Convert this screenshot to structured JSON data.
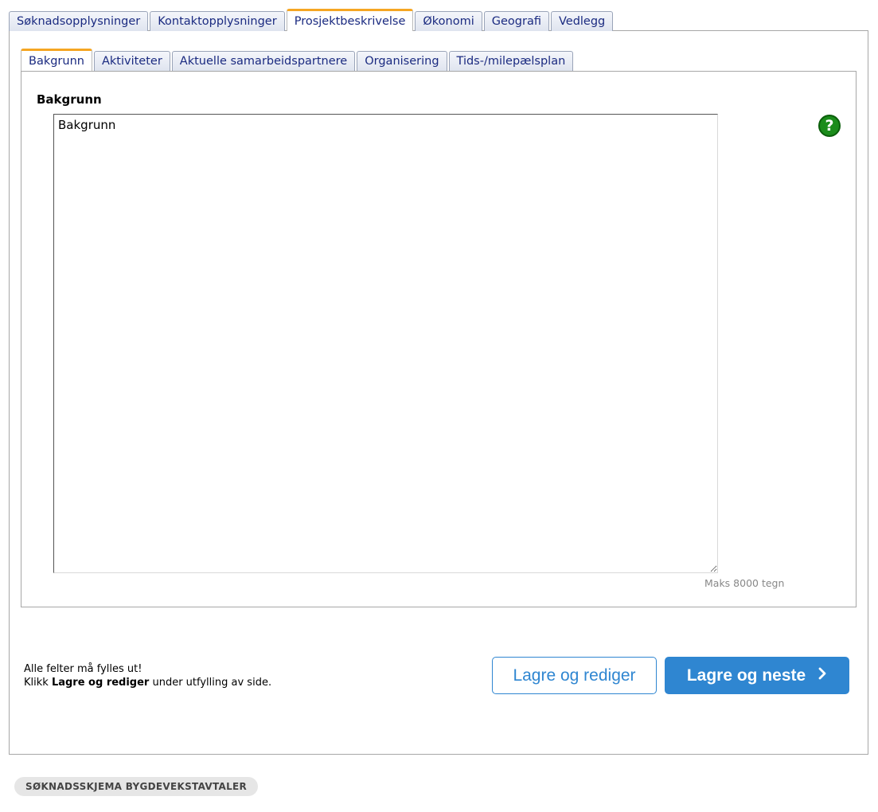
{
  "outer_tabs": [
    {
      "label": "Søknadsopplysninger",
      "active": false
    },
    {
      "label": "Kontaktopplysninger",
      "active": false
    },
    {
      "label": "Prosjektbeskrivelse",
      "active": true
    },
    {
      "label": "Økonomi",
      "active": false
    },
    {
      "label": "Geografi",
      "active": false
    },
    {
      "label": "Vedlegg",
      "active": false
    }
  ],
  "inner_tabs": [
    {
      "label": "Bakgrunn",
      "active": true
    },
    {
      "label": "Aktiviteter",
      "active": false
    },
    {
      "label": "Aktuelle samarbeidspartnere",
      "active": false
    },
    {
      "label": "Organisering",
      "active": false
    },
    {
      "label": "Tids-/milepælsplan",
      "active": false
    }
  ],
  "section": {
    "title": "Bakgrunn",
    "textarea_value": "Bakgrunn",
    "help_icon": "question-icon",
    "char_limit": "Maks 8000 tegn"
  },
  "notes": {
    "line1": "Alle felter må fylles ut!",
    "line2_prefix": "Klikk ",
    "line2_bold": "Lagre og rediger",
    "line2_suffix": " under utfylling av side."
  },
  "buttons": {
    "save_edit": "Lagre og rediger",
    "save_next": "Lagre og neste",
    "save_next_icon": "chevron-right-icon"
  },
  "footer": {
    "badge": "SØKNADSSKJEMA BYGDEVEKSTAVTALER"
  },
  "colors": {
    "accent": "#2f86d1",
    "active_tab_top": "#f5a623",
    "help_green": "#1b8c1b",
    "tab_text": "#1a2a80"
  }
}
